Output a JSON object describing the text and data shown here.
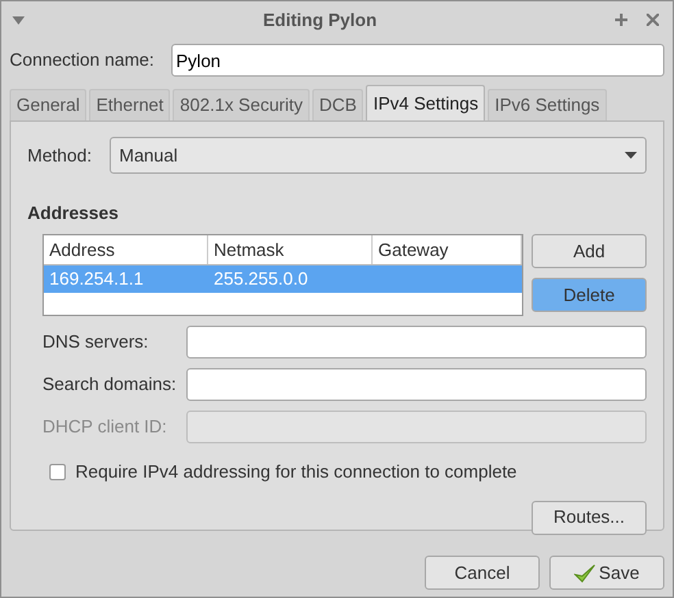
{
  "window": {
    "title": "Editing Pylon"
  },
  "connection_name": {
    "label": "Connection name:",
    "value": "Pylon"
  },
  "tabs": [
    {
      "label": "General",
      "selected": false
    },
    {
      "label": "Ethernet",
      "selected": false
    },
    {
      "label": "802.1x Security",
      "selected": false
    },
    {
      "label": "DCB",
      "selected": false
    },
    {
      "label": "IPv4 Settings",
      "selected": true
    },
    {
      "label": "IPv6 Settings",
      "selected": false
    }
  ],
  "method": {
    "label": "Method:",
    "value": "Manual"
  },
  "addresses": {
    "heading": "Addresses",
    "columns": [
      "Address",
      "Netmask",
      "Gateway"
    ],
    "rows": [
      {
        "cells": [
          "169.254.1.1",
          "255.255.0.0",
          ""
        ],
        "selected": true
      }
    ],
    "buttons": [
      {
        "label": "Add",
        "selected": false
      },
      {
        "label": "Delete",
        "selected": true
      }
    ]
  },
  "fields": [
    {
      "label": "DNS servers:",
      "disabled": false
    },
    {
      "label": "Search domains:",
      "disabled": false
    },
    {
      "label": "DHCP client ID:",
      "disabled": true
    }
  ],
  "require_ipv4": {
    "label": "Require IPv4 addressing for this connection to complete",
    "checked": false
  },
  "routes_button": "Routes...",
  "buttons": [
    {
      "label": "Cancel",
      "kind": "plain"
    },
    {
      "label": "Save",
      "kind": "confirm"
    }
  ]
}
